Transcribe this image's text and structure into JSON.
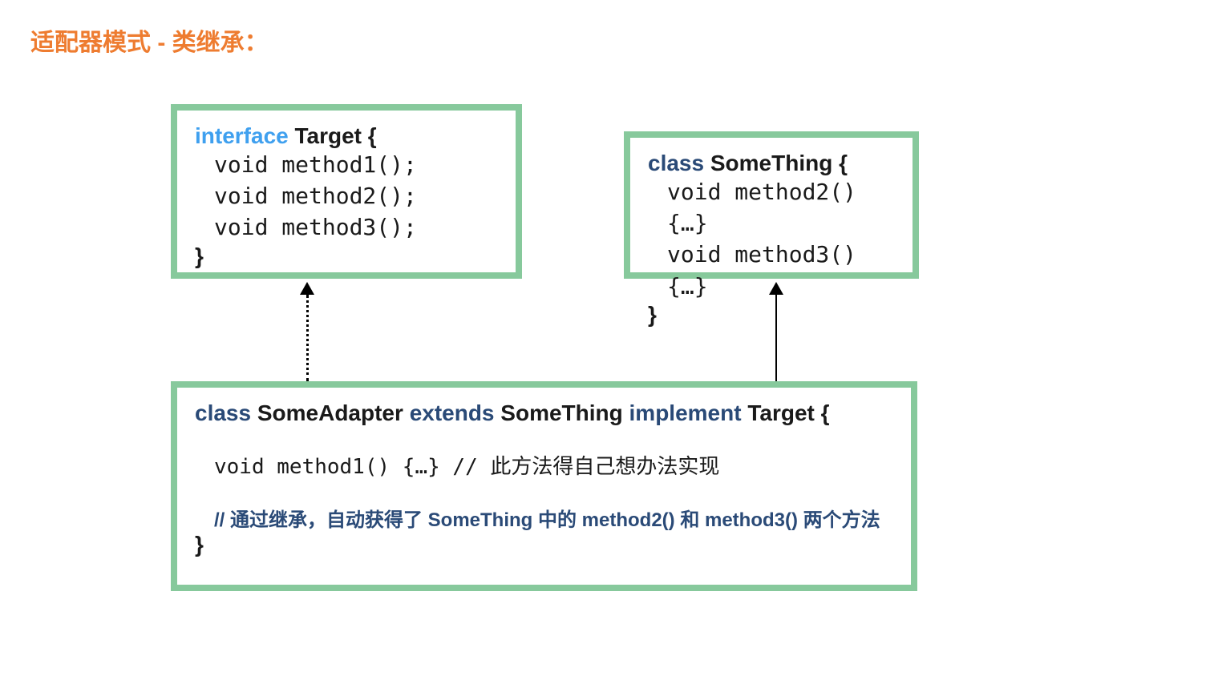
{
  "title": "适配器模式 - 类继承：",
  "target": {
    "keyword": "interface",
    "name": "Target {",
    "lines": [
      "void method1();",
      "void method2();",
      "void method3();"
    ],
    "close": "}"
  },
  "something": {
    "keyword": "class",
    "name": "SomeThing {",
    "lines": [
      "void method2() {…}",
      "void method3() {…}"
    ],
    "close": "}"
  },
  "adapter": {
    "kw_class": "class",
    "name1": "SomeAdapter",
    "kw_extends": "extends",
    "name2": "SomeThing",
    "kw_implement": "implement",
    "name3": "Target {",
    "method_line": "void method1() {…} // 此方法得自己想办法实现",
    "comment": "// 通过继承，自动获得了 SomeThing 中的 method2() 和 method3() 两个方法",
    "close": "}"
  }
}
